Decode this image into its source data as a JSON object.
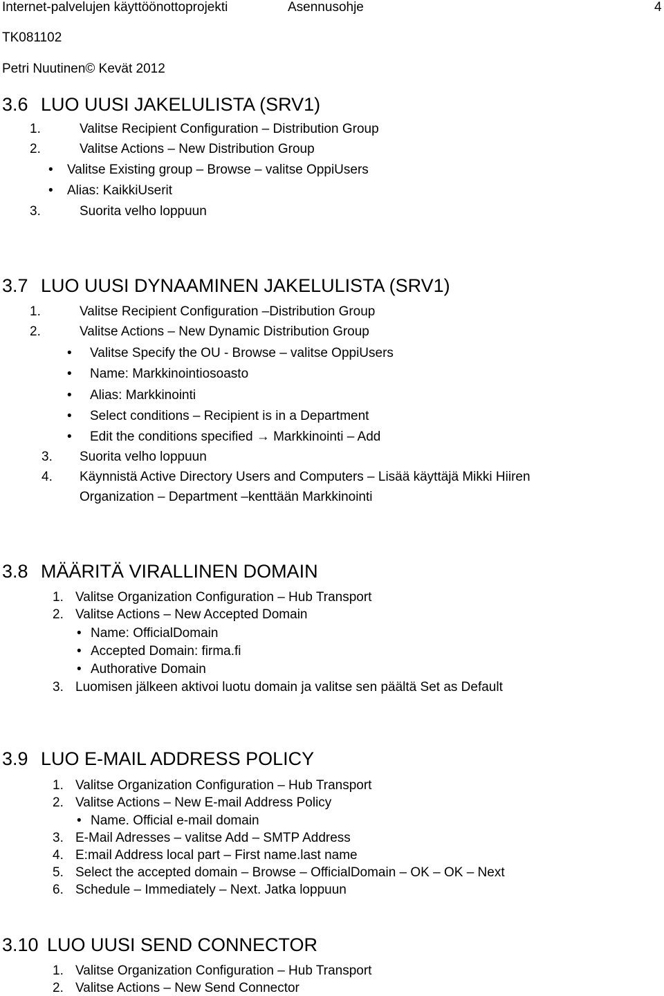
{
  "header": {
    "project_title": "Internet-palvelujen käyttöönottoprojekti",
    "doc_type": "Asennusohje",
    "page_number": "4",
    "course_code": "TK081102",
    "author_line": "Petri Nuutinen© Kevät 2012"
  },
  "sections": [
    {
      "number": "3.6",
      "title": "LUO UUSI JAKELULISTA (SRV1)",
      "items": [
        {
          "marker": "1.",
          "text": "Valitse Recipient Configuration – Distribution Group"
        },
        {
          "marker": "2.",
          "text": "Valitse Actions – New Distribution Group"
        },
        {
          "marker": "•",
          "text": "Valitse Existing group – Browse – valitse OppiUsers"
        },
        {
          "marker": "•",
          "text": "Alias: KaikkiUserit"
        },
        {
          "marker": "3.",
          "text": "Suorita velho loppuun"
        }
      ]
    },
    {
      "number": "3.7",
      "title": "LUO UUSI DYNAAMINEN JAKELULISTA (SRV1)",
      "items": [
        {
          "marker": "1.",
          "text": "Valitse Recipient Configuration –Distribution Group"
        },
        {
          "marker": "2.",
          "text": "Valitse Actions – New Dynamic Distribution Group"
        },
        {
          "marker": "•",
          "text": "Valitse Specify the OU - Browse – valitse OppiUsers"
        },
        {
          "marker": "•",
          "text": "Name: Markkinointiosoasto"
        },
        {
          "marker": "•",
          "text": "Alias: Markkinointi"
        },
        {
          "marker": "•",
          "text": "Select conditions – Recipient is in a Department"
        },
        {
          "marker": "•",
          "text": "Edit the conditions specified → Markkinointi – Add"
        },
        {
          "marker": "3.",
          "text": "Suorita velho loppuun"
        },
        {
          "marker": "4.",
          "text": "Käynnistä Active Directory Users and Computers – Lisää käyttäjä Mikki Hiiren"
        },
        {
          "marker": "",
          "text": "Organization – Department –kenttään Markkinointi"
        }
      ]
    },
    {
      "number": "3.8",
      "title": "MÄÄRITÄ VIRALLINEN DOMAIN",
      "items": [
        {
          "marker": "1.",
          "text": "Valitse Organization Configuration – Hub Transport"
        },
        {
          "marker": "2.",
          "text": "Valitse Actions – New Accepted Domain"
        },
        {
          "marker": "•",
          "text": "Name: OfficialDomain"
        },
        {
          "marker": "•",
          "text": "Accepted Domain: firma.fi"
        },
        {
          "marker": "•",
          "text": "Authorative Domain"
        },
        {
          "marker": "3.",
          "text": "Luomisen jälkeen aktivoi luotu domain ja valitse sen päältä Set as Default"
        }
      ]
    },
    {
      "number": "3.9",
      "title": "LUO E-MAIL ADDRESS POLICY",
      "items": [
        {
          "marker": "1.",
          "text": "Valitse Organization Configuration – Hub Transport"
        },
        {
          "marker": "2.",
          "text": "Valitse Actions – New E-mail Address Policy"
        },
        {
          "marker": "•",
          "text": "Name. Official e-mail domain"
        },
        {
          "marker": "3.",
          "text": "E-Mail Adresses – valitse Add – SMTP Address"
        },
        {
          "marker": "4.",
          "text": "E:mail Address local part – First name.last name"
        },
        {
          "marker": "5.",
          "text": "Select the accepted domain – Browse – OfficialDomain – OK – OK – Next"
        },
        {
          "marker": "6.",
          "text": "Schedule – Immediately – Next. Jatka loppuun"
        }
      ]
    },
    {
      "number": "3.10",
      "title": "LUO UUSI SEND CONNECTOR",
      "items": [
        {
          "marker": "1.",
          "text": "Valitse Organization Configuration – Hub Transport"
        },
        {
          "marker": "2.",
          "text": "Valitse Actions – New Send Connector"
        }
      ]
    }
  ]
}
